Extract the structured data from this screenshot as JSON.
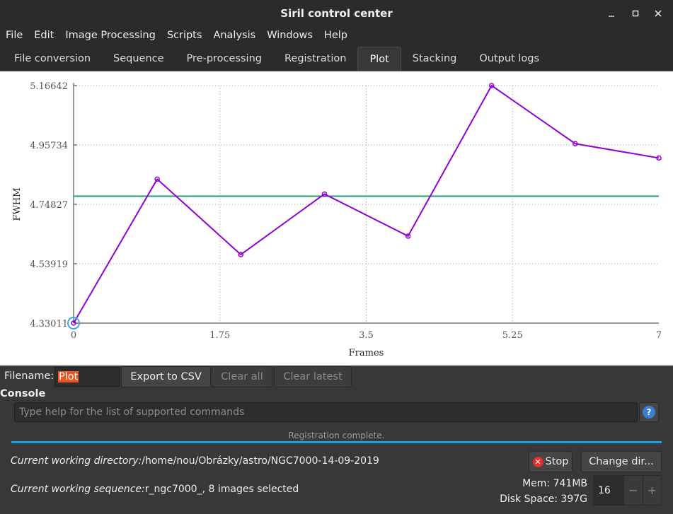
{
  "window": {
    "title": "Siril control center"
  },
  "menu": [
    "File",
    "Edit",
    "Image Processing",
    "Scripts",
    "Analysis",
    "Windows",
    "Help"
  ],
  "tabs": [
    {
      "label": "File conversion"
    },
    {
      "label": "Sequence"
    },
    {
      "label": "Pre-processing"
    },
    {
      "label": "Registration"
    },
    {
      "label": "Plot",
      "active": true
    },
    {
      "label": "Stacking"
    },
    {
      "label": "Output logs"
    }
  ],
  "chart_data": {
    "type": "line",
    "xlabel": "Frames",
    "ylabel": "FWHM",
    "xlim": [
      0,
      7
    ],
    "ylim": [
      4.33011,
      5.16642
    ],
    "xticks": [
      "0",
      "1.75",
      "3.5",
      "5.25",
      "7"
    ],
    "yticks": [
      "4.33011",
      "4.53919",
      "4.74827",
      "4.95734",
      "5.16642"
    ],
    "grid": true,
    "series": [
      {
        "x": [
          0,
          1,
          2,
          3,
          4,
          5,
          6,
          7
        ],
        "values": [
          4.33011,
          4.8369,
          4.5714,
          4.7845,
          4.6364,
          5.16642,
          4.9617,
          4.9114
        ],
        "color": "#9400d3"
      }
    ],
    "reference_line": {
      "y": 4.777,
      "color": "#1e9e7a"
    },
    "selected_point": 0
  },
  "toolbar": {
    "filename_label": "Filename:",
    "filename_value": "Plot",
    "export_label": "Export to CSV",
    "clear_all_label": "Clear all",
    "clear_latest_label": "Clear latest"
  },
  "console": {
    "label": "Console",
    "placeholder": "Type help for the list of supported commands",
    "help_glyph": "?"
  },
  "status": {
    "text": "Registration complete.",
    "progress": 1.0
  },
  "footer": {
    "cwd_label": "Current working directory:",
    "cwd_value": "/home/nou/Obrázky/astro/NGC7000-14-09-2019",
    "cws_label": "Current working sequence:",
    "cws_value": "r_ngc7000_, 8 images selected",
    "stop_label": "Stop",
    "change_dir_label": "Change dir...",
    "mem_text": "Mem: 741MB",
    "disk_text": "Disk Space: 397G",
    "threads_value": "16",
    "minus_glyph": "−",
    "plus_glyph": "+"
  },
  "colors": {
    "accent": "#e95420",
    "progress": "#1e9fe6",
    "series": "#9400d3",
    "reference": "#1e9e7a"
  }
}
